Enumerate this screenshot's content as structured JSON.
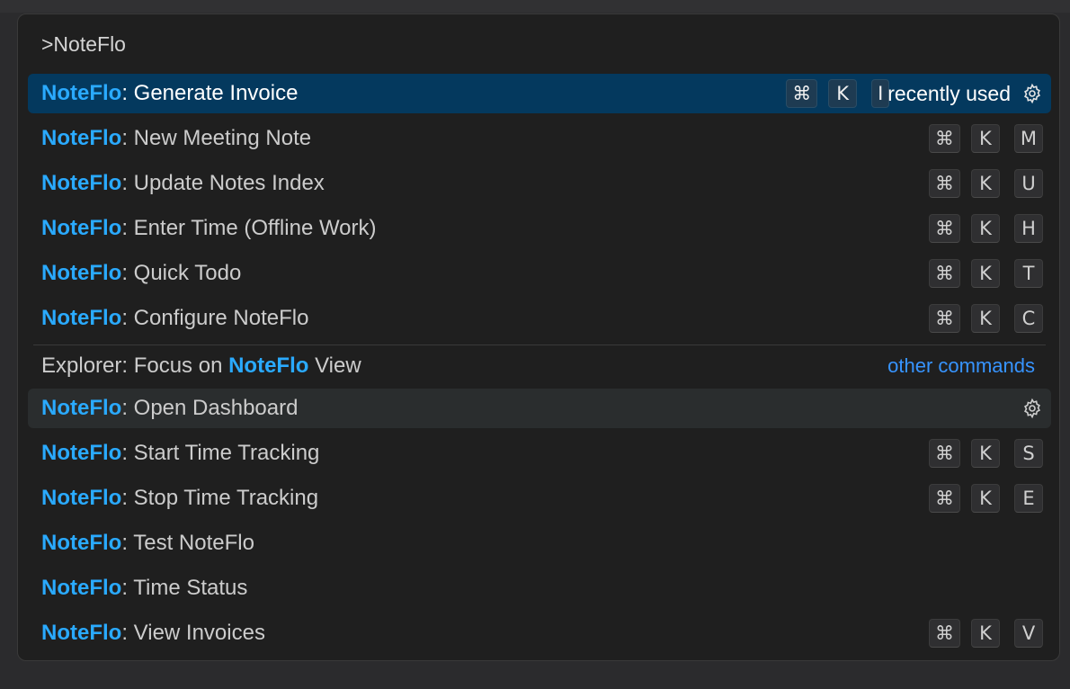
{
  "palette": {
    "query": ">NoteFlo",
    "highlight": "NoteFlo",
    "items": [
      {
        "prefix": "",
        "match": "NoteFlo",
        "suffix": ": Generate Invoice",
        "keys": [
          "⌘",
          "K",
          "I"
        ],
        "detail": "recently used",
        "gear": true,
        "state": "selected"
      },
      {
        "prefix": "",
        "match": "NoteFlo",
        "suffix": ": New Meeting Note",
        "keys": [
          "⌘",
          "K",
          "M"
        ]
      },
      {
        "prefix": "",
        "match": "NoteFlo",
        "suffix": ": Update Notes Index",
        "keys": [
          "⌘",
          "K",
          "U"
        ]
      },
      {
        "prefix": "",
        "match": "NoteFlo",
        "suffix": ": Enter Time (Offline Work)",
        "keys": [
          "⌘",
          "K",
          "H"
        ]
      },
      {
        "prefix": "",
        "match": "NoteFlo",
        "suffix": ": Quick Todo",
        "keys": [
          "⌘",
          "K",
          "T"
        ]
      },
      {
        "prefix": "",
        "match": "NoteFlo",
        "suffix": ": Configure NoteFlo",
        "keys": [
          "⌘",
          "K",
          "C"
        ]
      },
      {
        "prefix": "Explorer: Focus on ",
        "match": "NoteFlo",
        "suffix": " View",
        "keys": [],
        "group_label": "other commands"
      },
      {
        "prefix": "",
        "match": "NoteFlo",
        "suffix": ": Open Dashboard",
        "keys": [],
        "gear": true,
        "state": "hover"
      },
      {
        "prefix": "",
        "match": "NoteFlo",
        "suffix": ": Start Time Tracking",
        "keys": [
          "⌘",
          "K",
          "S"
        ]
      },
      {
        "prefix": "",
        "match": "NoteFlo",
        "suffix": ": Stop Time Tracking",
        "keys": [
          "⌘",
          "K",
          "E"
        ]
      },
      {
        "prefix": "",
        "match": "NoteFlo",
        "suffix": ": Test NoteFlo",
        "keys": []
      },
      {
        "prefix": "",
        "match": "NoteFlo",
        "suffix": ": Time Status",
        "keys": []
      },
      {
        "prefix": "",
        "match": "NoteFlo",
        "suffix": ": View Invoices",
        "keys": [
          "⌘",
          "K",
          "V"
        ]
      }
    ]
  },
  "icons": {
    "gear": "gear-icon"
  },
  "colors": {
    "background": "#1f1f1f",
    "selected_row": "#04395e",
    "hover_row": "#2a2d2e",
    "match_highlight": "#2aaaff",
    "link": "#3794ff",
    "text": "#cccccc"
  }
}
